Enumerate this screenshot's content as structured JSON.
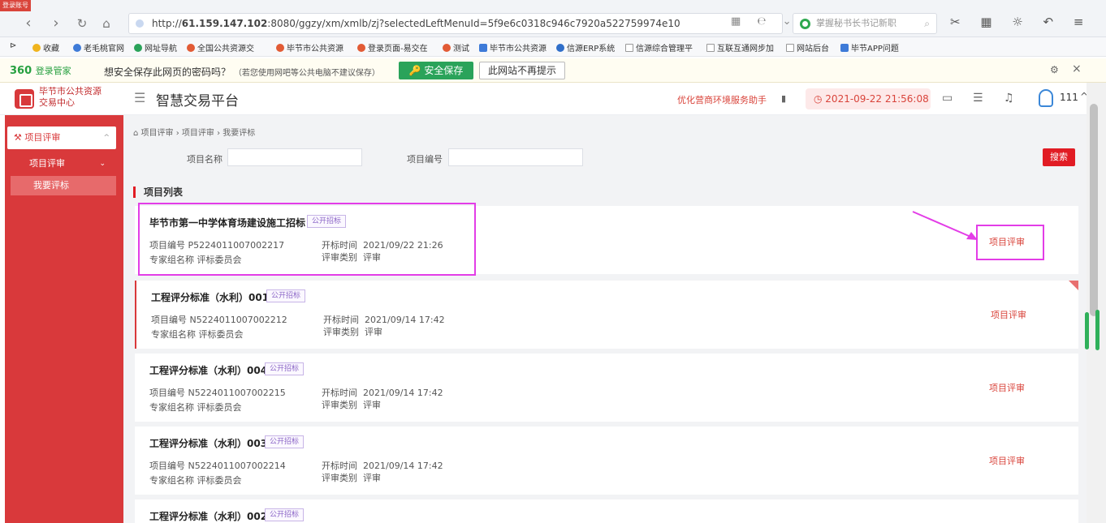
{
  "browser": {
    "badge": "登录账号",
    "url_prefix": "http://",
    "url_host": "61.159.147.102",
    "url_rest": ":8080/ggzy/xm/xmlb/zj?selectedLeftMenuId=5f9e6c0318c946c7920a522759974e10",
    "search_placeholder": "掌握秘书长书记新职",
    "bookmarks": [
      "收藏",
      "老毛桃官网",
      "网址导航",
      "全国公共资源交",
      "毕节市公共资源",
      "登录页面-易交在",
      "测试",
      "毕节市公共资源",
      "信源ERP系统",
      "信源综合管理平",
      "互联互通网步加",
      "网站后台",
      "毕节APP问题"
    ]
  },
  "pwbar": {
    "brand": "360",
    "brand_sub": "登录管家",
    "question": "想安全保存此网页的密码吗？",
    "note": "（若您使用网吧等公共电脑不建议保存）",
    "save_label": "安全保存",
    "never_label": "此网站不再提示"
  },
  "header": {
    "logo_line1": "毕节市公共资源",
    "logo_line2": "交易中心",
    "app_title": "智慧交易平台",
    "assistant": "优化营商环境服务助手",
    "datetime": "2021-09-22 21:56:08",
    "user": "111"
  },
  "sidebar": {
    "group": "项目评审",
    "sub": "项目评审",
    "active": "我要评标"
  },
  "breadcrumb": "项目评审 › 项目评审 › 我要评标",
  "filters": {
    "name_label": "项目名称",
    "code_label": "项目编号",
    "search_label": "搜索"
  },
  "list": {
    "title": "项目列表",
    "labels": {
      "code": "项目编号",
      "group": "专家组名称",
      "open_time": "开标时间",
      "category": "评审类别"
    },
    "items": [
      {
        "title": "毕节市第一中学体育场建设施工招标",
        "tag": "公开招标",
        "code": "P5224011007002217",
        "group": "评标委员会",
        "open_time": "2021/09/22 21:26",
        "category": "评审",
        "action": "项目评审"
      },
      {
        "title": "工程评分标准（水利）001",
        "tag": "公开招标",
        "code": "N5224011007002212",
        "group": "评标委员会",
        "open_time": "2021/09/14 17:42",
        "category": "评审",
        "action": "项目评审"
      },
      {
        "title": "工程评分标准（水利）004",
        "tag": "公开招标",
        "code": "N5224011007002215",
        "group": "评标委员会",
        "open_time": "2021/09/14 17:42",
        "category": "评审",
        "action": "项目评审"
      },
      {
        "title": "工程评分标准（水利）003",
        "tag": "公开招标",
        "code": "N5224011007002214",
        "group": "评标委员会",
        "open_time": "2021/09/14 17:42",
        "category": "评审",
        "action": "项目评审"
      },
      {
        "title": "工程评分标准（水利）002",
        "tag": "公开招标",
        "code": "",
        "group": "",
        "open_time": "",
        "category": "",
        "action": ""
      }
    ]
  },
  "colors": {
    "brand_red": "#d9393b",
    "highlight": "#e33de7",
    "action": "#d9443b"
  }
}
